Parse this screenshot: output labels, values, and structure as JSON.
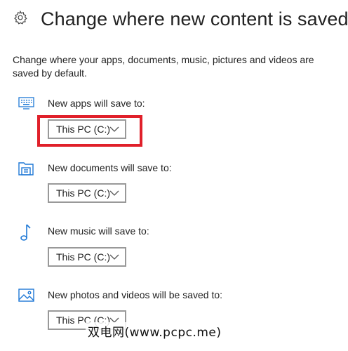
{
  "header": {
    "title": "Change where new content is saved",
    "icon": "gear-icon"
  },
  "description": "Change where your apps, documents, music, pictures and videos are saved by default.",
  "sections": [
    {
      "label": "New apps will save to:",
      "icon": "monitor-icon",
      "selected": "This PC (C:)",
      "highlighted": true
    },
    {
      "label": "New documents will save to:",
      "icon": "documents-folder-icon",
      "selected": "This PC (C:)",
      "highlighted": false
    },
    {
      "label": "New music will save to:",
      "icon": "music-note-icon",
      "selected": "This PC (C:)",
      "highlighted": false
    },
    {
      "label": "New photos and videos will be saved to:",
      "icon": "picture-icon",
      "selected": "This PC (C:)",
      "highlighted": false
    }
  ],
  "watermark": "双电网(www.pcpc.me)",
  "colors": {
    "icon_accent": "#1e78d6",
    "highlight": "#e0202a",
    "dropdown_border": "#999999"
  }
}
